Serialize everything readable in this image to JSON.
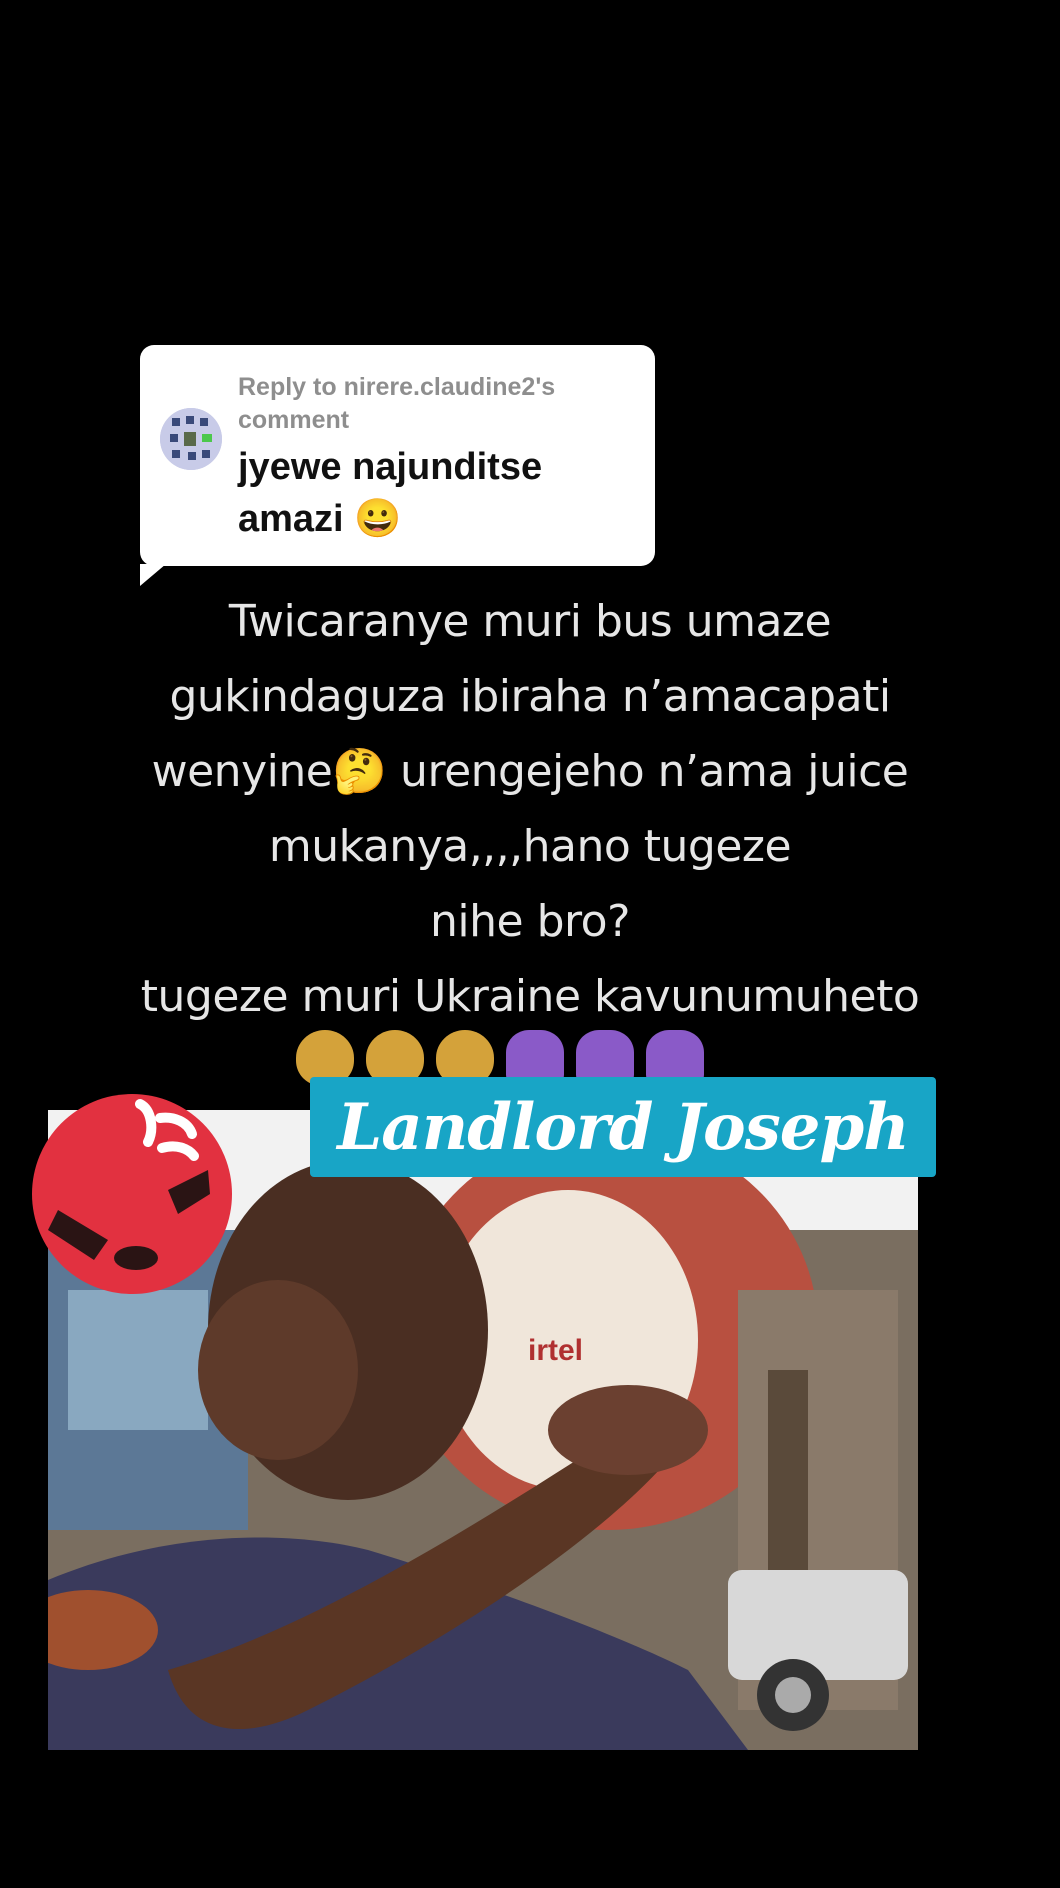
{
  "reply": {
    "header": "Reply to nirere.claudine2's comment",
    "text": "jyewe najunditse amazi 😀"
  },
  "caption": {
    "lines": [
      "Twicaranye muri bus umaze",
      "gukindaguza ibiraha n’amacapati",
      "wenyine🤔 urengejeho n’ama juice",
      "mukanya,,,,hano tugeze",
      "nihe bro?",
      "tugeze muri Ukraine kavunumuheto"
    ],
    "emojis": [
      "🙈",
      "🙈",
      "🙈",
      "🙆",
      "🙆",
      "🙆"
    ]
  },
  "photo": {
    "title": "Landlord Joseph",
    "sign_text": "irtel"
  },
  "icons": {
    "avatar": "user-avatar-icon",
    "angry": "angry-face-icon"
  },
  "colors": {
    "background": "#000000",
    "badge": "#18a5c6",
    "angry": "#e23140"
  }
}
